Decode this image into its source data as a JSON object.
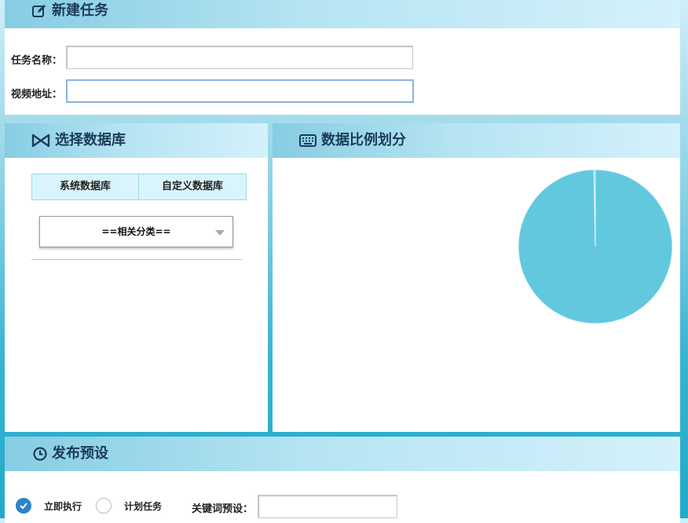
{
  "new_task": {
    "title": "新建任务",
    "task_name_label": "任务名称：",
    "task_name_value": "",
    "video_url_label": "视频地址：",
    "video_url_value": ""
  },
  "database": {
    "title": "选择数据库",
    "tabs": [
      "系统数据库",
      "自定义数据库"
    ],
    "category_select": "==相关分类=="
  },
  "ratio": {
    "title": "数据比例划分"
  },
  "chart_data": {
    "type": "pie",
    "values": [
      99.7,
      0.3
    ],
    "colors": [
      "#62c8de",
      "#62c8de"
    ]
  },
  "publish": {
    "title": "发布预设",
    "option_immediate": "立即执行",
    "option_scheduled": "计划任务",
    "keyword_label": "关键词预设：",
    "keyword_value": "",
    "selected": "立即执行"
  },
  "colors": {
    "accent": "#2d82c9",
    "header_text": "#1d3b5a",
    "pie": "#62c8de"
  }
}
